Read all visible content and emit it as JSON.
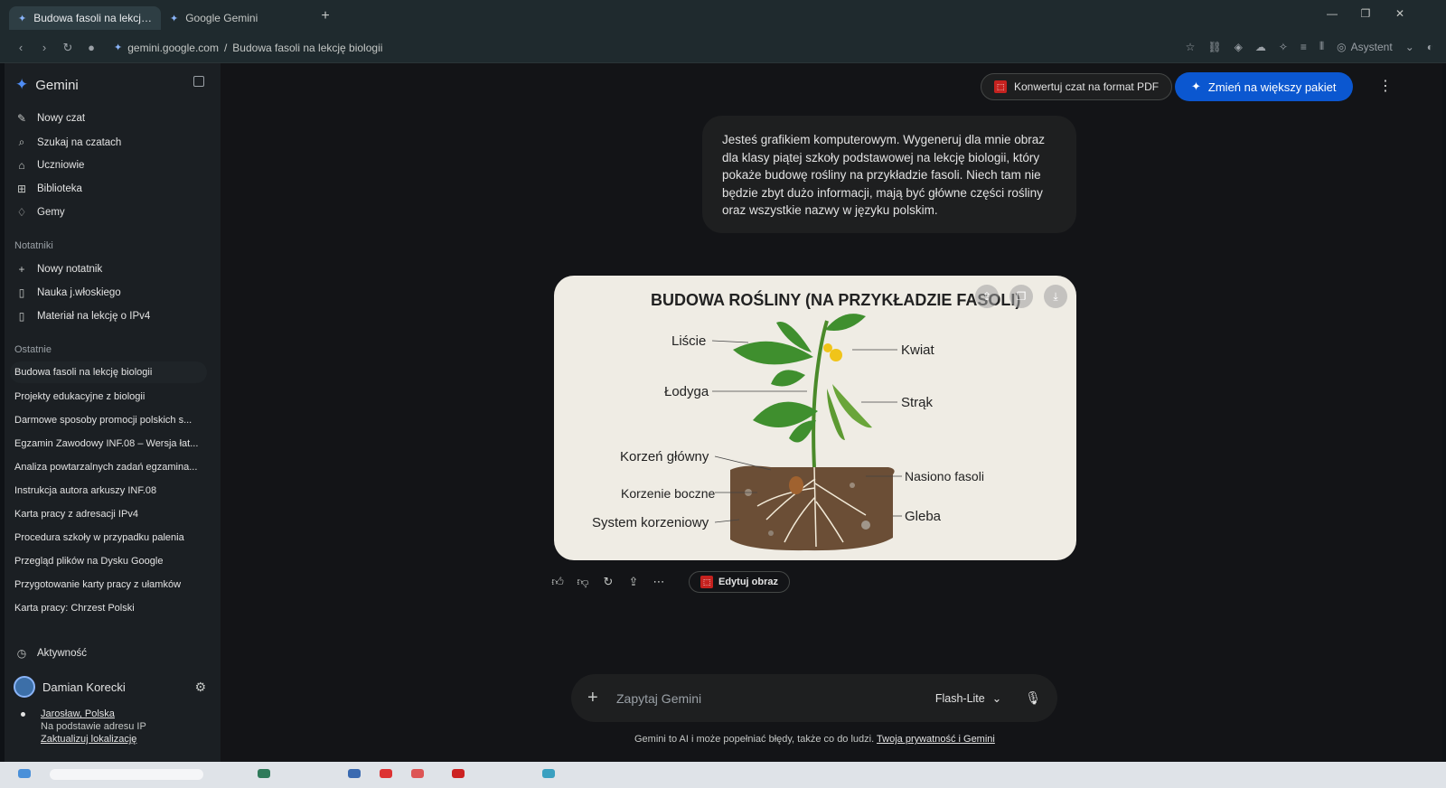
{
  "browser": {
    "tabs": [
      {
        "label": "Budowa fasoli na lekcję biologii",
        "active": true
      },
      {
        "label": "Google Gemini",
        "active": false
      }
    ],
    "url_domain": "gemini.google.com",
    "url_sep": "/",
    "url_path": "Budowa fasoli na lekcję biologii",
    "assistant_label": "Asystent"
  },
  "sidebar": {
    "brand": "Gemini",
    "menu": [
      {
        "label": "Nowy czat",
        "icon": "edit-icon"
      },
      {
        "label": "Szukaj na czatach",
        "icon": "search-icon"
      },
      {
        "label": "Uczniowie",
        "icon": "graduation-cap-icon"
      },
      {
        "label": "Biblioteka",
        "icon": "grid-icon"
      },
      {
        "label": "Gemy",
        "icon": "gem-icon"
      }
    ],
    "notebooks_title": "Notatniki",
    "notebooks": [
      {
        "label": "Nowy notatnik",
        "icon": "plus-icon"
      },
      {
        "label": "Nauka j.włoskiego",
        "icon": "notebook-icon"
      },
      {
        "label": "Materiał na lekcję o IPv4",
        "icon": "notebook-icon"
      }
    ],
    "recent_title": "Ostatnie",
    "recent": [
      "Budowa fasoli na lekcję biologii",
      "Projekty edukacyjne z biologii",
      "Darmowe sposoby promocji polskich s...",
      "Egzamin Zawodowy INF.08 – Wersja łat...",
      "Analiza powtarzalnych zadań egzamina...",
      "Instrukcja autora arkuszy INF.08",
      "Karta pracy z adresacji IPv4",
      "Procedura szkoły w przypadku palenia",
      "Przegląd plików na Dysku Google",
      "Przygotowanie karty pracy z ułamków",
      "Karta pracy: Chrzest Polski"
    ],
    "activity": "Aktywność",
    "user_name": "Damian Korecki",
    "location": "Jarosław, Polska",
    "location_source": "Na podstawie adresu IP",
    "update_location": "Zaktualizuj lokalizację"
  },
  "header": {
    "pdf_button": "Konwertuj czat na format PDF",
    "upgrade_button": "Zmień na większy pakiet"
  },
  "chat": {
    "user_message": "Jesteś grafikiem komputerowym. Wygeneruj dla mnie obraz dla klasy piątej szkoły podstawowej na lekcję biologii, który pokaże budowę rośliny na przykładzie fasoli. Niech tam nie będzie zbyt dużo informacji, mają być główne części rośliny oraz wszystkie nazwy w języku polskim.",
    "image": {
      "title": "BUDOWA ROŚLINY (NA PRZYKŁADZIE FASOLI)",
      "labels_left": [
        "Liście",
        "Łodyga",
        "Korzeń główny",
        "Korzenie boczne",
        "System korzeniowy"
      ],
      "labels_right": [
        "Kwiat",
        "Strąk",
        "Nasiono fasoli",
        "Gleba"
      ]
    },
    "edit_image_button": "Edytuj obraz"
  },
  "composer": {
    "placeholder": "Zapytaj Gemini",
    "model": "Flash-Lite"
  },
  "disclaimer": {
    "text": "Gemini to AI i może popełniać błędy, także co do ludzi.",
    "link": "Twoja prywatność i Gemini"
  },
  "colors": {
    "accent": "#0b57d0",
    "pdf_red": "#c5221f",
    "background": "#131417",
    "sidebar": "#1b1f23"
  }
}
